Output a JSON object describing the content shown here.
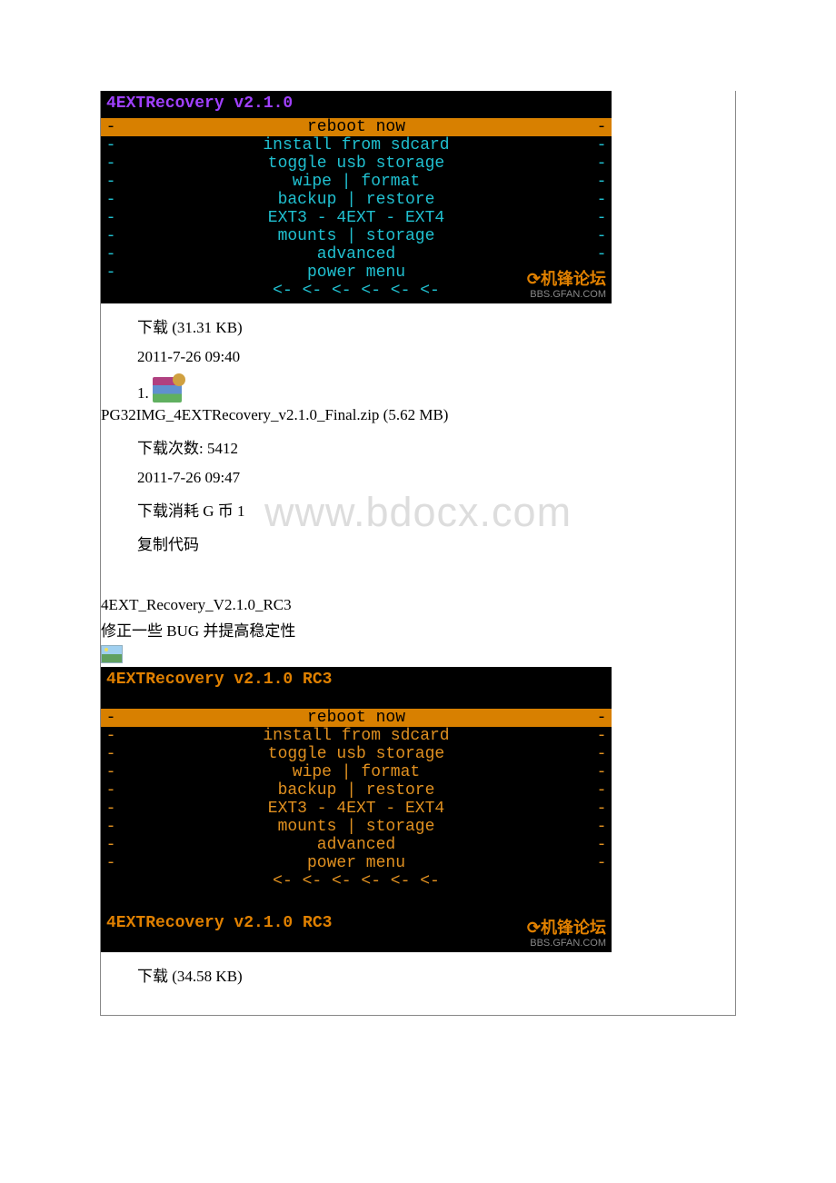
{
  "watermark": "www.bdocx.com",
  "logo_brand": "机锋论坛",
  "logo_sub": "BBS.GFAN.COM",
  "recov1": {
    "title": "4EXTRecovery v2.1.0",
    "hl": "reboot now",
    "items": [
      "install from sdcard",
      "toggle usb storage",
      "wipe | format",
      "backup | restore",
      "EXT3 - 4EXT - EXT4",
      "mounts | storage",
      "advanced",
      "power menu"
    ],
    "arrows": "<- <- <- <- <- <-"
  },
  "info1": {
    "download": "下载 (31.31 KB)",
    "date": "2011-7-26 09:40",
    "listnum": "1.",
    "zip": "PG32IMG_4EXTRecovery_v2.1.0_Final.zip (5.62 MB)",
    "dlcount": "下载次数: 5412",
    "date2": "2011-7-26 09:47",
    "cost": "下载消耗 G 币 1",
    "copy": "复制代码"
  },
  "sec2": {
    "title": "4EXT_Recovery_V2.1.0_RC3",
    "desc": "修正一些 BUG 并提高稳定性"
  },
  "recov2": {
    "title": "4EXTRecovery v2.1.0 RC3",
    "hl": "reboot now",
    "items": [
      "install from sdcard",
      "toggle usb storage",
      "wipe | format",
      "backup | restore",
      "EXT3 - 4EXT - EXT4",
      "mounts | storage",
      "advanced",
      "power menu"
    ],
    "arrows": "<- <- <- <- <- <-",
    "footer": "4EXTRecovery v2.1.0 RC3"
  },
  "info2": {
    "download": "下载 (34.58 KB)"
  }
}
